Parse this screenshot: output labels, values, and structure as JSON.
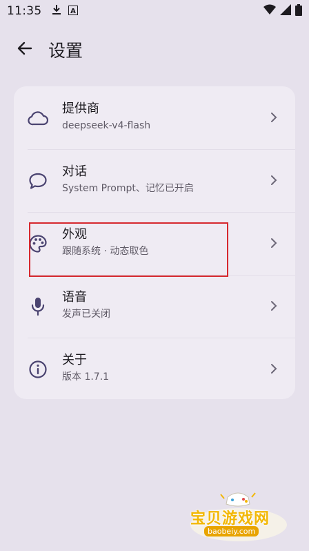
{
  "status_bar": {
    "time": "11:35",
    "left_icons": [
      "download-icon",
      "a-notification-icon"
    ],
    "right_icons": [
      "wifi-icon",
      "signal-icon",
      "battery-icon"
    ]
  },
  "app_bar": {
    "title": "设置",
    "back_icon": "arrow-left-icon"
  },
  "settings": {
    "items": [
      {
        "title": "提供商",
        "subtitle": "deepseek-v4-flash",
        "icon": "cloud-icon"
      },
      {
        "title": "对话",
        "subtitle": "System Prompt、记忆已开启",
        "icon": "chat-bubble-icon"
      },
      {
        "title": "外观",
        "subtitle": "跟随系统 · 动态取色",
        "icon": "palette-icon"
      },
      {
        "title": "语音",
        "subtitle": "发声已关闭",
        "icon": "microphone-icon"
      },
      {
        "title": "关于",
        "subtitle": "版本 1.7.1",
        "icon": "info-icon"
      }
    ]
  },
  "watermark": {
    "text": "宝贝游戏网",
    "url": "baobeiy.com"
  },
  "colors": {
    "background": "#e6e1ec",
    "card": "#efebf3",
    "icon": "#4a4370",
    "highlight": "#d6282e"
  }
}
